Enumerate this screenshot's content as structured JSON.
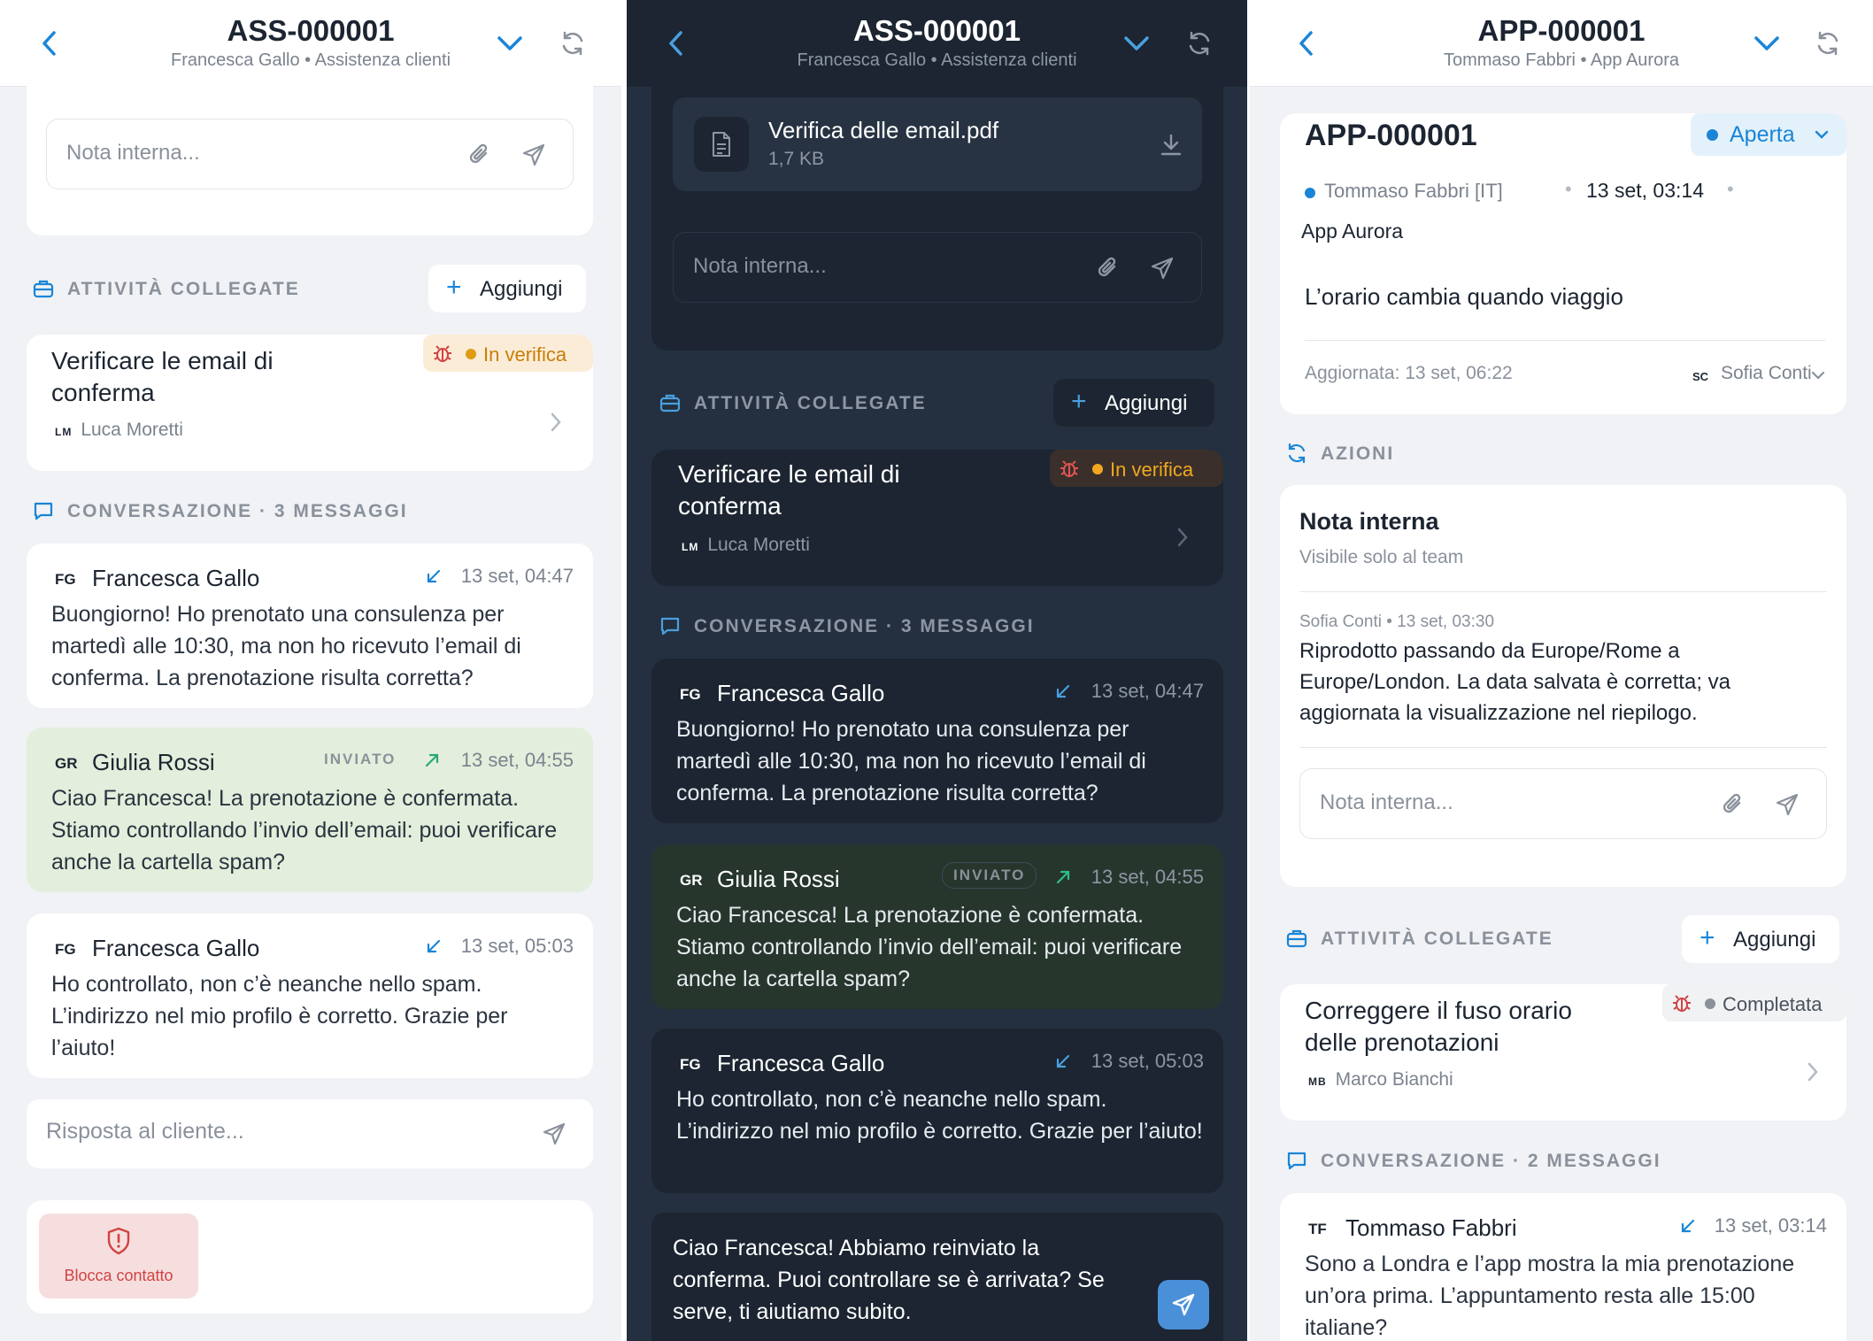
{
  "colors": {
    "accent": "#1a85d6",
    "status_in_verifica": "#e09b12",
    "status_aperta": "#1a85d6",
    "status_completata": "#8a919b",
    "danger": "#d14343"
  },
  "panel1": {
    "header": {
      "title": "ASS-000001",
      "subtitle": "Francesca Gallo • Assistenza clienti"
    },
    "note_placeholder": "Nota interna...",
    "activities": {
      "section": "ATTIVITÀ COLLEGATE",
      "add": "Aggiungi",
      "task": {
        "title": "Verificare le email di conferma",
        "status": "In verifica",
        "assignee_initials": "LM",
        "assignee": "Luca Moretti"
      }
    },
    "conversation": {
      "section": "CONVERSAZIONE · 3 MESSAGGI",
      "messages": [
        {
          "initials": "FG",
          "name": "Francesca Gallo",
          "time": "13 set, 04:47",
          "body": "Buongiorno! Ho prenotato una consulenza per martedì alle 10:30, ma non ho ricevuto l’email di conferma. La prenotazione risulta corretta?"
        },
        {
          "initials": "GR",
          "name": "Giulia Rossi",
          "tag": "INVIATO",
          "time": "13 set, 04:55",
          "body": "Ciao Francesca! La prenotazione è confermata. Stiamo controllando l’invio dell’email: puoi verificare anche la cartella spam?"
        },
        {
          "initials": "FG",
          "name": "Francesca Gallo",
          "time": "13 set, 05:03",
          "body": "Ho controllato, non c’è neanche nello spam. L’indirizzo nel mio profilo è corretto. Grazie per l’aiuto!"
        }
      ]
    },
    "reply_placeholder": "Risposta al cliente...",
    "block": "Blocca contatto"
  },
  "panel2": {
    "header": {
      "title": "ASS-000001",
      "subtitle": "Francesca Gallo • Assistenza clienti"
    },
    "attachment": {
      "name": "Verifica delle email.pdf",
      "size": "1,7 KB"
    },
    "note_placeholder": "Nota interna...",
    "activities": {
      "section": "ATTIVITÀ COLLEGATE",
      "add": "Aggiungi",
      "task": {
        "title": "Verificare le email di conferma",
        "status": "In verifica",
        "assignee_initials": "LM",
        "assignee": "Luca Moretti"
      }
    },
    "conversation": {
      "section": "CONVERSAZIONE · 3 MESSAGGI",
      "messages": [
        {
          "initials": "FG",
          "name": "Francesca Gallo",
          "time": "13 set, 04:47",
          "body": "Buongiorno! Ho prenotato una consulenza per martedì alle 10:30, ma non ho ricevuto l’email di conferma. La prenotazione risulta corretta?"
        },
        {
          "initials": "GR",
          "name": "Giulia Rossi",
          "tag": "INVIATO",
          "time": "13 set, 04:55",
          "body": "Ciao Francesca! La prenotazione è confermata. Stiamo controllando l’invio dell’email: puoi verificare anche la cartella spam?"
        },
        {
          "initials": "FG",
          "name": "Francesca Gallo",
          "time": "13 set, 05:03",
          "body": "Ho controllato, non c’è neanche nello spam. L’indirizzo nel mio profilo è corretto. Grazie per l’aiuto!"
        }
      ]
    },
    "composer_text": "Ciao Francesca! Abbiamo reinviato la conferma. Puoi controllare se è arrivata? Se serve, ti aiutiamo subito."
  },
  "panel3": {
    "header": {
      "title": "APP-000001",
      "subtitle": "Tommaso Fabbri • App Aurora"
    },
    "ticket": {
      "id": "APP-000001",
      "status": "Aperta",
      "requester": "Tommaso Fabbri [IT]",
      "date": "13 set, 03:14",
      "app": "App Aurora",
      "subject": "L’orario cambia quando viaggio",
      "updated": "Aggiornata: 13 set, 06:22",
      "agent_initials": "SC",
      "agent": "Sofia Conti"
    },
    "actions_section": "AZIONI",
    "note": {
      "title": "Nota interna",
      "subtitle": "Visibile solo al team",
      "meta": "Sofia Conti • 13 set, 03:30",
      "body": "Riprodotto passando da Europe/Rome a Europe/London. La data salvata è corretta; va aggiornata la visualizzazione nel riepilogo.",
      "placeholder": "Nota interna..."
    },
    "activities": {
      "section": "ATTIVITÀ COLLEGATE",
      "add": "Aggiungi",
      "task": {
        "title": "Correggere il fuso orario delle prenotazioni",
        "status": "Completata",
        "assignee_initials": "MB",
        "assignee": "Marco Bianchi"
      }
    },
    "conversation": {
      "section": "CONVERSAZIONE · 2 MESSAGGI",
      "messages": [
        {
          "initials": "TF",
          "name": "Tommaso Fabbri",
          "time": "13 set, 03:14",
          "body": "Sono a Londra e l’app mostra la mia prenotazione un’ora prima. L’appuntamento resta alle 15:00 italiane?"
        }
      ]
    }
  }
}
